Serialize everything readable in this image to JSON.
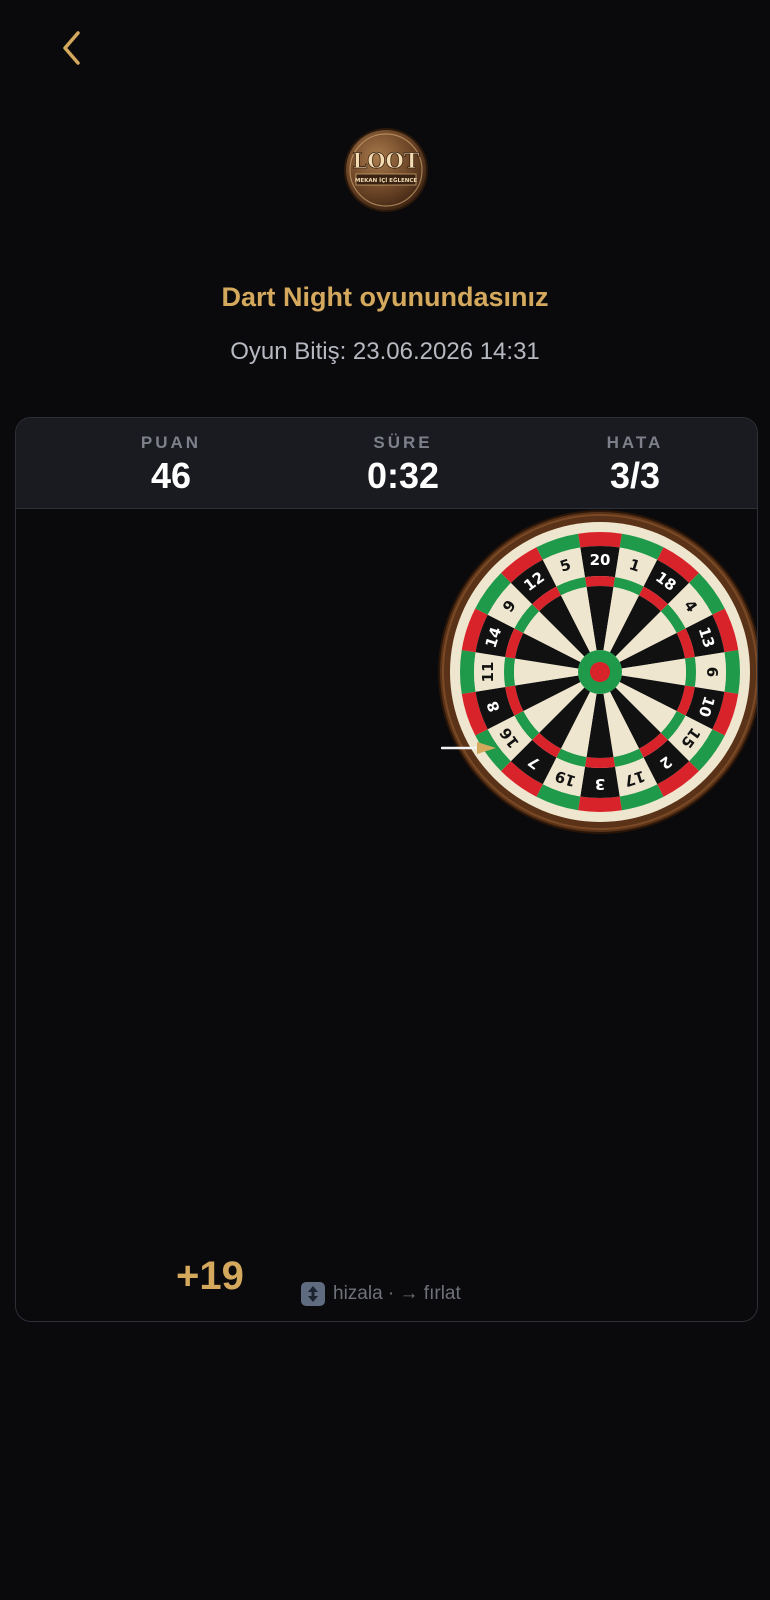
{
  "header": {
    "back_icon": "chevron-left-icon",
    "logo": {
      "main_text": "LOOT",
      "ribbon_text": "MEKAN İÇİ EĞLENCE"
    },
    "title": "Dart Night oyunundasınız",
    "subtitle": "Oyun Bitiş: 23.06.2026 14:31"
  },
  "stats": {
    "score_label": "PUAN",
    "score_value": "46",
    "time_label": "SÜRE",
    "time_value": "0:32",
    "miss_label": "HATA",
    "miss_value": "3/3"
  },
  "board": {
    "numbers": [
      "20",
      "1",
      "18",
      "4",
      "13",
      "6",
      "10",
      "15",
      "2",
      "17",
      "3",
      "19",
      "7",
      "16",
      "8",
      "11",
      "14",
      "9",
      "12",
      "5"
    ],
    "colors": {
      "light": "#efe6cf",
      "dark": "#111111",
      "red": "#d9232b",
      "green": "#1e9a4a",
      "rim": "#5a3218"
    }
  },
  "score_popup": "+19",
  "hint": {
    "key_icon": "up-down-arrows-icon",
    "text": "hizala · → fırlat"
  },
  "theme": {
    "accent": "#d4a95e",
    "background": "#0a0a0c"
  }
}
